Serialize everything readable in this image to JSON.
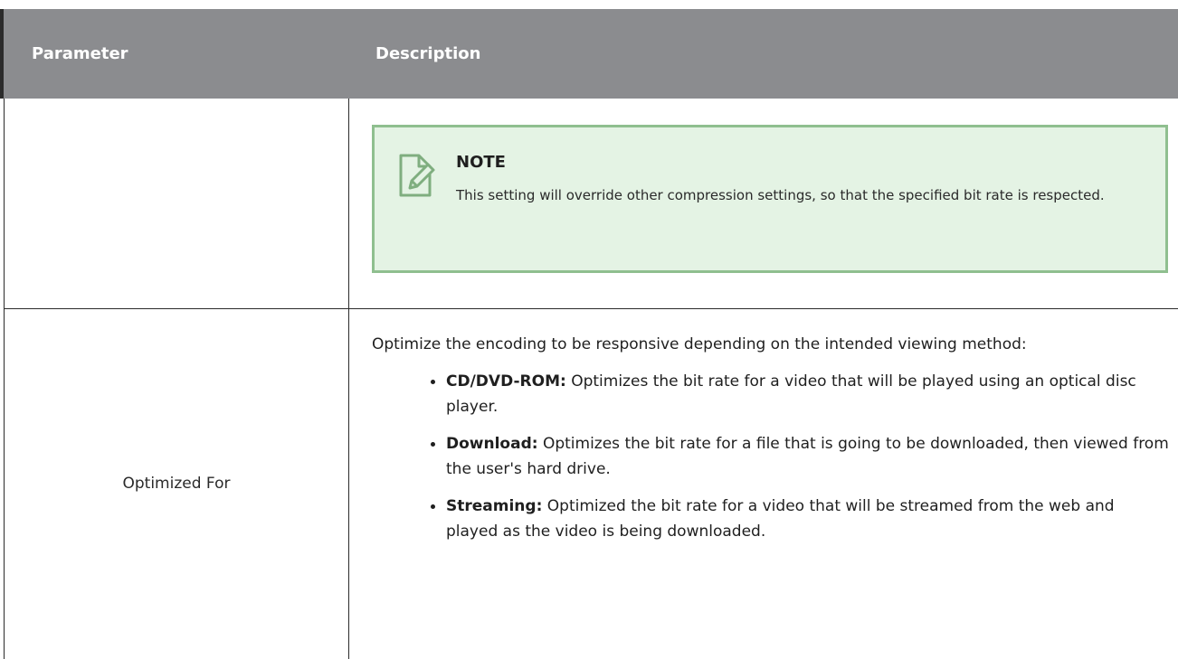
{
  "table": {
    "headers": {
      "parameter": "Parameter",
      "description": "Description"
    },
    "note": {
      "icon": "note-edit-icon",
      "title": "NOTE",
      "text": "This setting will override other compression settings, so that the specified bit rate is respected."
    },
    "optimized_for": {
      "parameter": "Optimized For",
      "intro": "Optimize the encoding to be responsive depending on the intended viewing method:",
      "options": [
        {
          "term": "CD/DVD-ROM:",
          "text": " Optimizes the bit rate for a video that will be played using an optical disc player."
        },
        {
          "term": "Download:",
          "text": " Optimizes the bit rate for a file that is going to be downloaded, then viewed from the user's hard drive."
        },
        {
          "term": "Streaming:",
          "text": " Optimized the bit rate for a video that will be streamed from the web and played as the video is being downloaded."
        }
      ]
    }
  },
  "colors": {
    "header_bg": "#8b8c8f",
    "note_bg": "#e4f3e4",
    "note_border": "#8fbf8f",
    "rule": "#2b2b2b"
  }
}
